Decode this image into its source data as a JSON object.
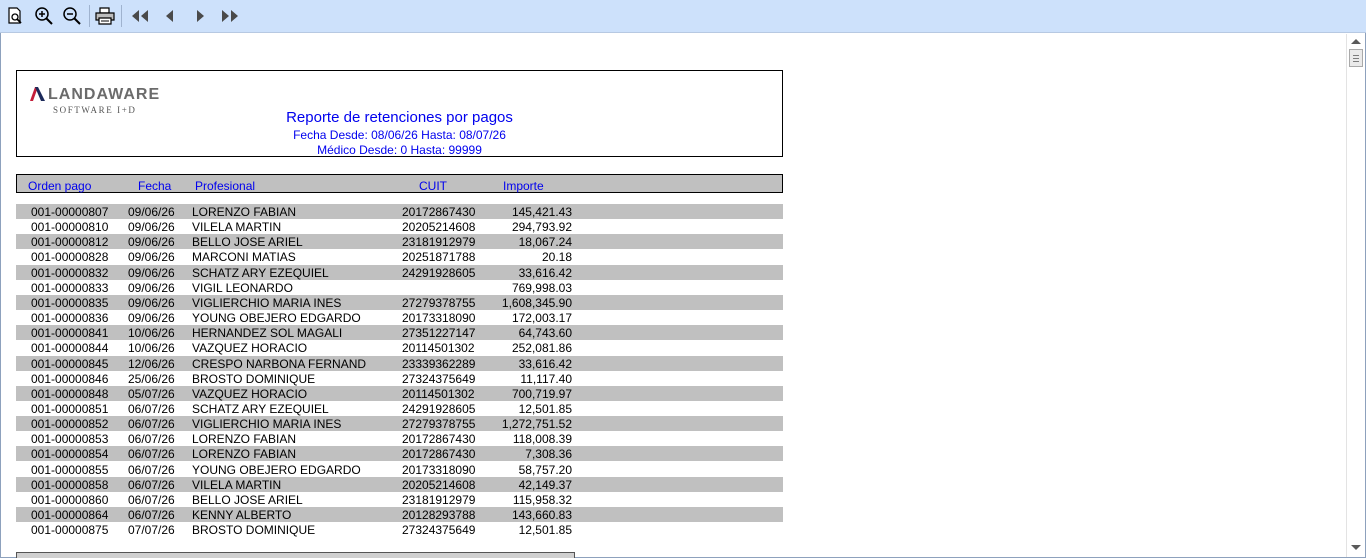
{
  "toolbar": {
    "buttons": [
      {
        "name": "page-preview-icon"
      },
      {
        "name": "zoom-in-icon"
      },
      {
        "name": "zoom-out-icon"
      },
      {
        "name": "printer-icon"
      },
      {
        "name": "first-page-icon"
      },
      {
        "name": "previous-page-icon"
      },
      {
        "name": "next-page-icon"
      },
      {
        "name": "last-page-icon"
      }
    ]
  },
  "report": {
    "logo_word": "LANDAWARE",
    "logo_sub": "SOFTWARE I+D",
    "title": "Reporte de retenciones por pagos",
    "subtitle_dates": "Fecha Desde: 08/06/26 Hasta: 08/07/26",
    "subtitle_medico": "Médico Desde: 0 Hasta: 99999",
    "columns": {
      "orden": "Orden pago",
      "fecha": "Fecha",
      "profesional": "Profesional",
      "cuit": "CUIT",
      "importe": "Importe"
    },
    "rows": [
      {
        "orden": "001-00000807",
        "fecha": "09/06/26",
        "profesional": "LORENZO FABIAN",
        "cuit": "20172867430",
        "importe": "145,421.43"
      },
      {
        "orden": "001-00000810",
        "fecha": "09/06/26",
        "profesional": "VILELA  MARTIN",
        "cuit": "20205214608",
        "importe": "294,793.92"
      },
      {
        "orden": "001-00000812",
        "fecha": "09/06/26",
        "profesional": "BELLO JOSE ARIEL",
        "cuit": "23181912979",
        "importe": "18,067.24"
      },
      {
        "orden": "001-00000828",
        "fecha": "09/06/26",
        "profesional": "MARCONI MATIAS",
        "cuit": "20251871788",
        "importe": "20.18"
      },
      {
        "orden": "001-00000832",
        "fecha": "09/06/26",
        "profesional": "SCHATZ ARY EZEQUIEL",
        "cuit": "24291928605",
        "importe": "33,616.42"
      },
      {
        "orden": "001-00000833",
        "fecha": "09/06/26",
        "profesional": "VIGIL  LEONARDO",
        "cuit": "",
        "importe": "769,998.03"
      },
      {
        "orden": "001-00000835",
        "fecha": "09/06/26",
        "profesional": "VIGLIERCHIO MARIA INES",
        "cuit": "27279378755",
        "importe": "1,608,345.90"
      },
      {
        "orden": "001-00000836",
        "fecha": "09/06/26",
        "profesional": "YOUNG OBEJERO EDGARDO",
        "cuit": "20173318090",
        "importe": "172,003.17"
      },
      {
        "orden": "001-00000841",
        "fecha": "10/06/26",
        "profesional": "HERNANDEZ SOL MAGALI",
        "cuit": "27351227147",
        "importe": "64,743.60"
      },
      {
        "orden": "001-00000844",
        "fecha": "10/06/26",
        "profesional": "VAZQUEZ HORACIO",
        "cuit": "20114501302",
        "importe": "252,081.86"
      },
      {
        "orden": "001-00000845",
        "fecha": "12/06/26",
        "profesional": "CRESPO NARBONA FERNAND",
        "cuit": "23339362289",
        "importe": "33,616.42"
      },
      {
        "orden": "001-00000846",
        "fecha": "25/06/26",
        "profesional": "BROSTO DOMINIQUE",
        "cuit": "27324375649",
        "importe": "11,117.40"
      },
      {
        "orden": "001-00000848",
        "fecha": "05/07/26",
        "profesional": "VAZQUEZ HORACIO",
        "cuit": "20114501302",
        "importe": "700,719.97"
      },
      {
        "orden": "001-00000851",
        "fecha": "06/07/26",
        "profesional": "SCHATZ ARY EZEQUIEL",
        "cuit": "24291928605",
        "importe": "12,501.85"
      },
      {
        "orden": "001-00000852",
        "fecha": "06/07/26",
        "profesional": "VIGLIERCHIO MARIA INES",
        "cuit": "27279378755",
        "importe": "1,272,751.52"
      },
      {
        "orden": "001-00000853",
        "fecha": "06/07/26",
        "profesional": "LORENZO FABIAN",
        "cuit": "20172867430",
        "importe": "118,008.39"
      },
      {
        "orden": "001-00000854",
        "fecha": "06/07/26",
        "profesional": "LORENZO FABIAN",
        "cuit": "20172867430",
        "importe": "7,308.36"
      },
      {
        "orden": "001-00000855",
        "fecha": "06/07/26",
        "profesional": "YOUNG OBEJERO EDGARDO",
        "cuit": "20173318090",
        "importe": "58,757.20"
      },
      {
        "orden": "001-00000858",
        "fecha": "06/07/26",
        "profesional": "VILELA  MARTIN",
        "cuit": "20205214608",
        "importe": "42,149.37"
      },
      {
        "orden": "001-00000860",
        "fecha": "06/07/26",
        "profesional": "BELLO JOSE ARIEL",
        "cuit": "23181912979",
        "importe": "115,958.32"
      },
      {
        "orden": "001-00000864",
        "fecha": "06/07/26",
        "profesional": "KENNY ALBERTO",
        "cuit": "20128293788",
        "importe": "143,660.83"
      },
      {
        "orden": "001-00000875",
        "fecha": "07/07/26",
        "profesional": "BROSTO DOMINIQUE",
        "cuit": "27324375649",
        "importe": "12,501.85"
      }
    ]
  },
  "colors": {
    "toolbar_bg": "#cde1fb",
    "title_blue": "#0000ee",
    "row_shade": "#c0c0c0",
    "logo_red": "#c41e3a"
  }
}
